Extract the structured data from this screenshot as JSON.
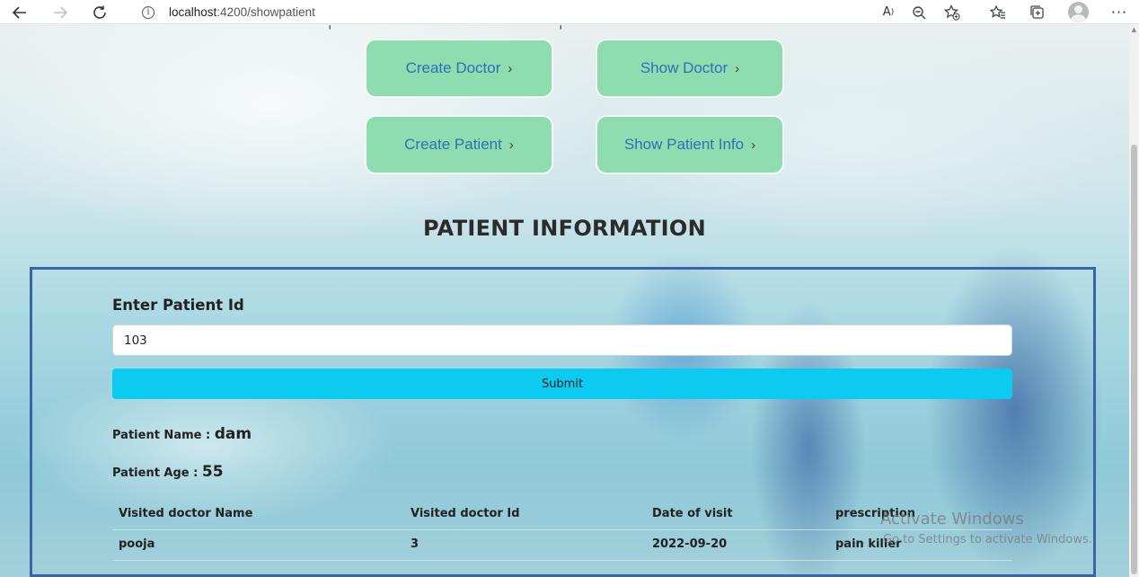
{
  "browser": {
    "url_host": "localhost",
    "url_path": ":4200/showpatient",
    "icons": [
      "back-arrow-icon",
      "forward-arrow-icon",
      "refresh-icon",
      "info-icon",
      "read-aloud-icon",
      "zoom-out-icon",
      "add-favorite-icon",
      "favorites-icon",
      "collections-icon",
      "profile-icon",
      "more-icon"
    ]
  },
  "nav": {
    "create_doctor": "Create Doctor",
    "show_doctor": "Show Doctor",
    "create_patient": "Create Patient",
    "show_patient_info": "Show Patient Info",
    "chevron": "›"
  },
  "page": {
    "title": "PATIENT INFORMATION"
  },
  "form": {
    "id_label": "Enter Patient Id",
    "id_value": "103",
    "submit_label": "Submit"
  },
  "patient": {
    "name_label": "Patient Name : ",
    "name_value": "dam",
    "age_label": "Patient Age : ",
    "age_value": "55"
  },
  "visits": {
    "headers": [
      "Visited doctor Name",
      "Visited doctor Id",
      "Date of visit",
      "prescription"
    ],
    "rows": [
      [
        "pooja",
        "3",
        "2022-09-20",
        "pain killer"
      ]
    ]
  },
  "watermark": {
    "line1": "Activate Windows",
    "line2": "Go to Settings to activate Windows."
  },
  "colors": {
    "nav_button_bg": "#8fdcb0",
    "nav_button_text": "#2f6fb8",
    "panel_border": "#3b64a8",
    "submit_bg": "#0dcaf0"
  }
}
